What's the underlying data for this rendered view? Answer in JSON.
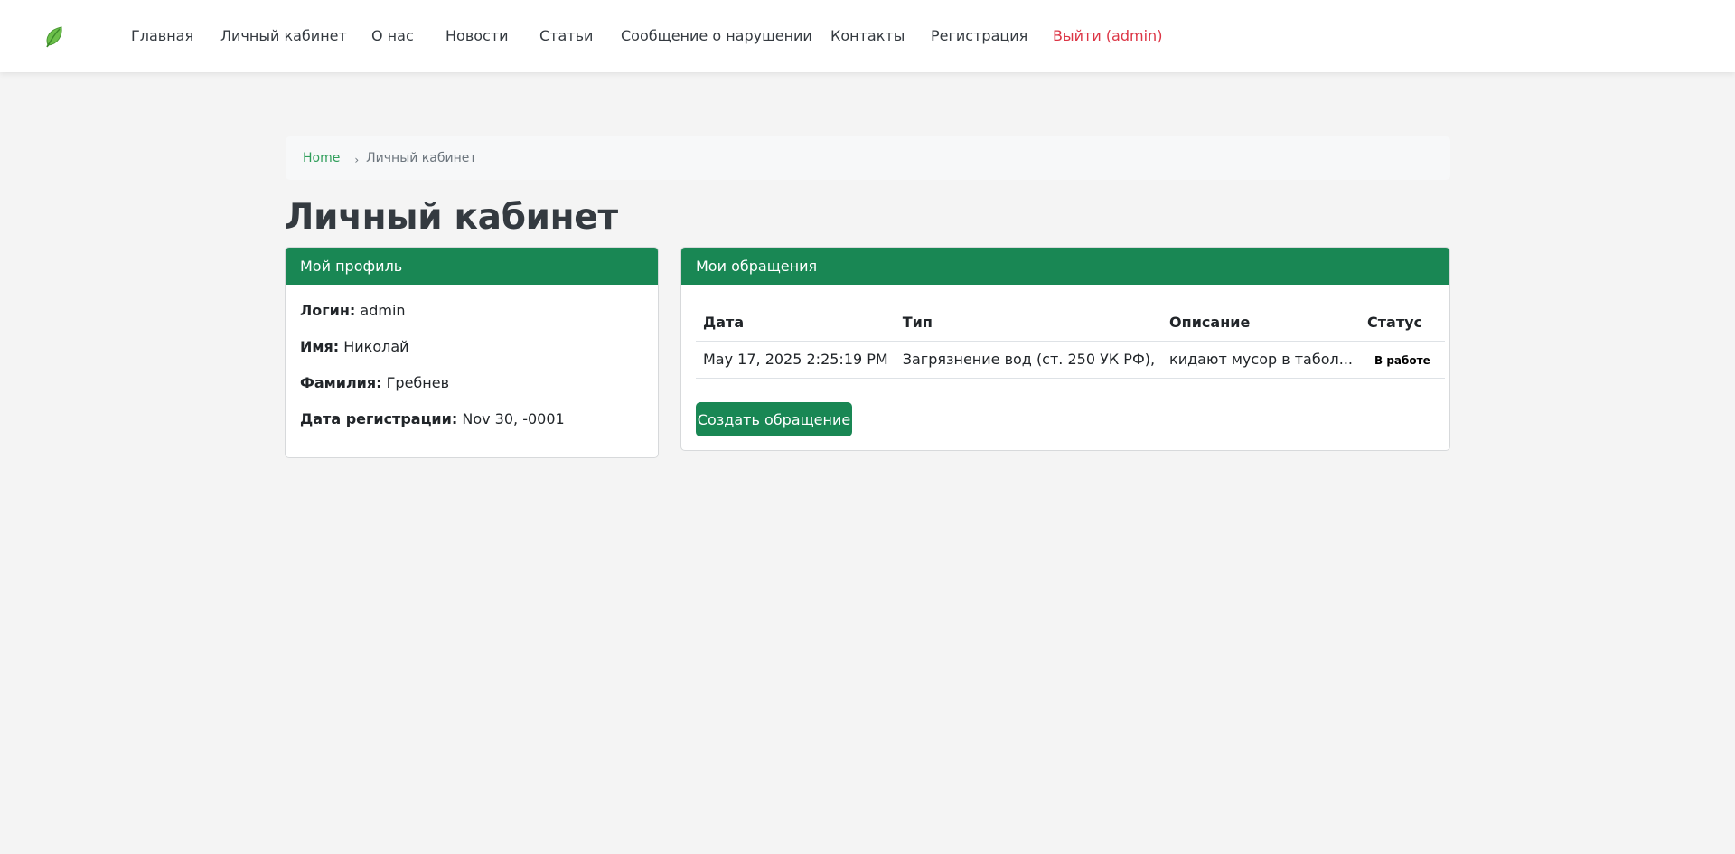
{
  "nav": {
    "items": [
      {
        "label": "Главная"
      },
      {
        "label": "Личный кабинет"
      },
      {
        "label": "О нас"
      },
      {
        "label": "Новости"
      },
      {
        "label": "Статьи"
      },
      {
        "label": "Сообщение о нарушении"
      },
      {
        "label": "Контакты"
      },
      {
        "label": "Регистрация"
      }
    ],
    "logout_label": "Выйти (admin)"
  },
  "breadcrumb": {
    "home": "Home",
    "separator": "›",
    "current": "Личный кабинет"
  },
  "page_title": "Личный кабинет",
  "profile": {
    "header": "Мой профиль",
    "fields": [
      {
        "label": "Логин:",
        "value": "admin"
      },
      {
        "label": "Имя:",
        "value": "Николай"
      },
      {
        "label": "Фамилия:",
        "value": "Гребнев"
      },
      {
        "label": "Дата регистрации:",
        "value": "Nov 30, -0001"
      }
    ]
  },
  "requests": {
    "header": "Мои обращения",
    "columns": [
      "Дата",
      "Тип",
      "Описание",
      "Статус"
    ],
    "rows": [
      {
        "date": "May 17, 2025 2:25:19 PM",
        "type": "Загрязнение вод (ст. 250 УК РФ),",
        "description": "кидают мусор в табол...",
        "status": "В работе"
      }
    ],
    "create_button": "Создать обращение"
  },
  "colors": {
    "accent": "#198754",
    "logout": "#dc3545",
    "link": "#2f9e5a"
  },
  "icons": {
    "logo": "leaf-icon"
  }
}
